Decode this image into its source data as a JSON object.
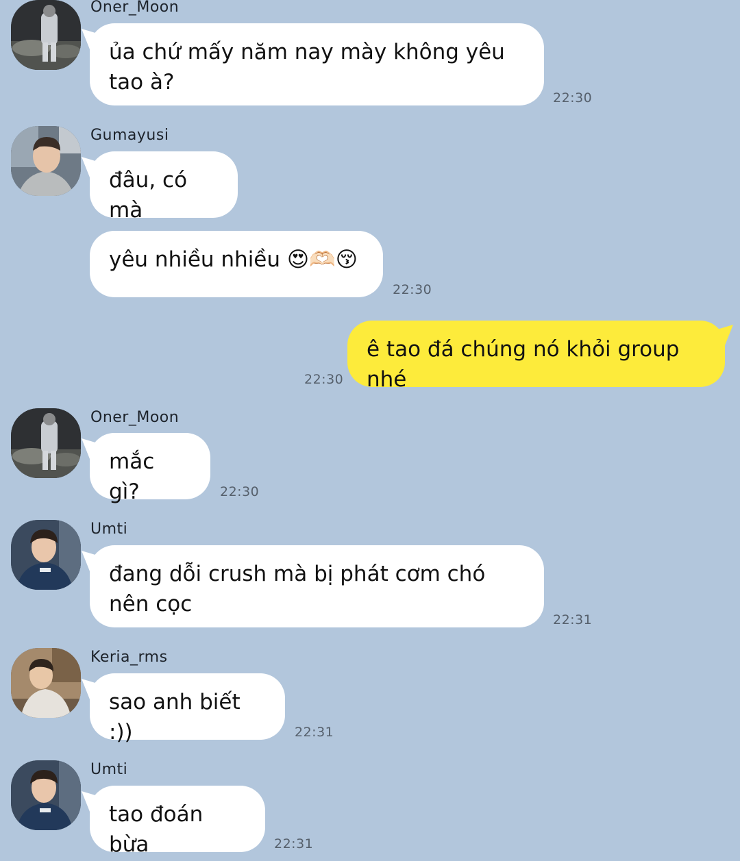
{
  "chat": {
    "messages": [
      {
        "sender": "Oner_Moon",
        "text": "ủa chứ mấy năm nay mày không yêu tao à?",
        "time": "22:30"
      },
      {
        "sender": "Gumayusi",
        "text": "đâu, có mà",
        "time": ""
      },
      {
        "sender": "",
        "text": "yêu nhiều nhiều 😍🫶🏻😚",
        "time": "22:30"
      },
      {
        "sender": "",
        "text": "ê tao đá chúng nó khỏi group nhé",
        "time": "22:30"
      },
      {
        "sender": "Oner_Moon",
        "text": "mắc gì?",
        "time": "22:30"
      },
      {
        "sender": "Umti",
        "text": "đang dỗi crush mà bị phát cơm chó nên cọc",
        "time": "22:31"
      },
      {
        "sender": "Keria_rms",
        "text": "sao anh biết :))",
        "time": "22:31"
      },
      {
        "sender": "Umti",
        "text": "tao đoán bừa",
        "time": "22:31"
      }
    ]
  },
  "avatars": {
    "oner": "avatar-photo-oner",
    "gumayusi": "avatar-photo-gumayusi",
    "umti": "avatar-photo-umti",
    "keria": "avatar-photo-keria"
  },
  "colors": {
    "background": "#b2c6dc",
    "incoming_bubble": "#ffffff",
    "outgoing_bubble": "#fdeb3b"
  }
}
